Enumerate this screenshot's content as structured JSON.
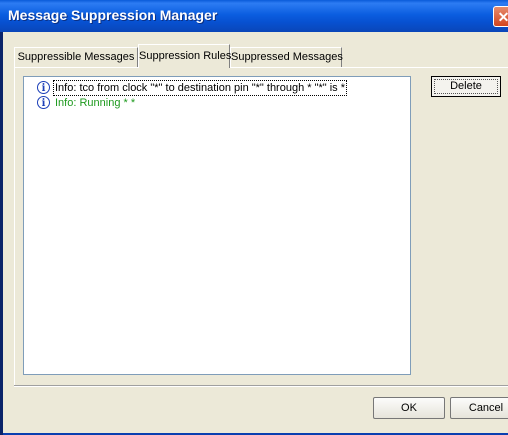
{
  "window": {
    "title": "Message Suppression Manager",
    "close_symbol": "✕"
  },
  "tabs": [
    {
      "label": "Suppressible Messages",
      "active": false
    },
    {
      "label": "Suppression Rules",
      "active": true
    },
    {
      "label": "Suppressed Messages",
      "active": false
    }
  ],
  "rules": [
    {
      "icon": "info-icon",
      "text": "Info: tco from clock \"*\" to destination pin \"*\" through * \"*\" is *",
      "color": "#000000",
      "selected": true
    },
    {
      "icon": "info-icon",
      "text": "Info: Running * *",
      "color": "#1e9a1e",
      "selected": false
    }
  ],
  "buttons": {
    "delete": "Delete",
    "ok": "OK",
    "cancel": "Cancel"
  }
}
